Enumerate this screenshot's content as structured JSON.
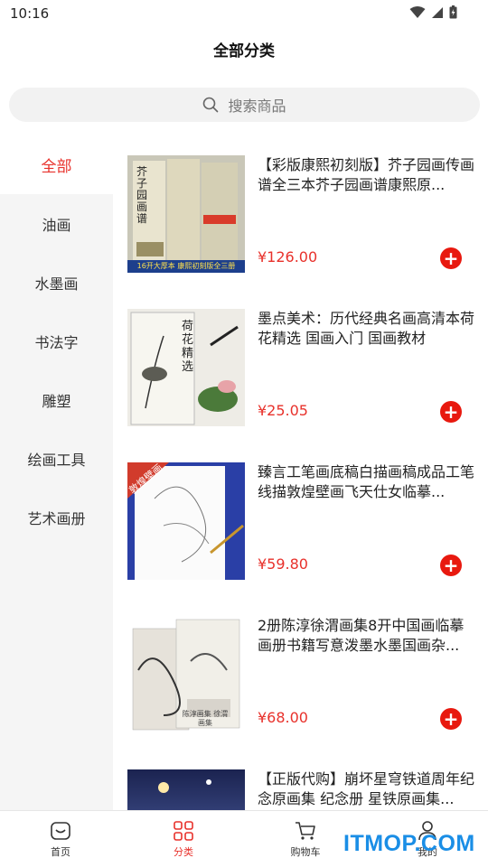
{
  "status": {
    "time": "10:16"
  },
  "header": {
    "title": "全部分类"
  },
  "search": {
    "placeholder": "搜索商品"
  },
  "sidebar": {
    "items": [
      {
        "label": "全部",
        "active": true
      },
      {
        "label": "油画"
      },
      {
        "label": "水墨画"
      },
      {
        "label": "书法字"
      },
      {
        "label": "雕塑"
      },
      {
        "label": "绘画工具"
      },
      {
        "label": "艺术画册"
      }
    ]
  },
  "products": [
    {
      "title": "【彩版康熙初刻版】芥子园画传画谱全三本芥子园画谱康熙原...",
      "price": "¥126.00",
      "cover_text": "芥子园画谱",
      "banner_text": "16开大厚本 康熙初刻版全三册"
    },
    {
      "title": "墨点美术：历代经典名画高清本荷花精选 国画入门 国画教材",
      "price": "¥25.05",
      "cover_text": "荷花精选"
    },
    {
      "title": "臻言工笔画底稿白描画稿成品工笔线描敦煌壁画飞天仕女临摹...",
      "price": "¥59.80",
      "cover_text": "敦煌壁画"
    },
    {
      "title": "2册陈淳徐渭画集8开中国画临摹画册书籍写意泼墨水墨国画杂...",
      "price": "¥68.00",
      "cover_text": "陈淳画集 徐渭画集"
    },
    {
      "title": "【正版代购】崩坏星穹铁道周年纪念原画集 纪念册 星铁原画集...",
      "price": ""
    }
  ],
  "tabbar": {
    "items": [
      {
        "label": "首页",
        "icon": "home-icon"
      },
      {
        "label": "分类",
        "icon": "category-icon",
        "active": true
      },
      {
        "label": "购物车",
        "icon": "cart-icon"
      },
      {
        "label": "我的",
        "icon": "user-icon"
      }
    ]
  },
  "watermark": "ITMOP.COM",
  "colors": {
    "accent": "#e8312b",
    "add_button": "#e8190f"
  }
}
